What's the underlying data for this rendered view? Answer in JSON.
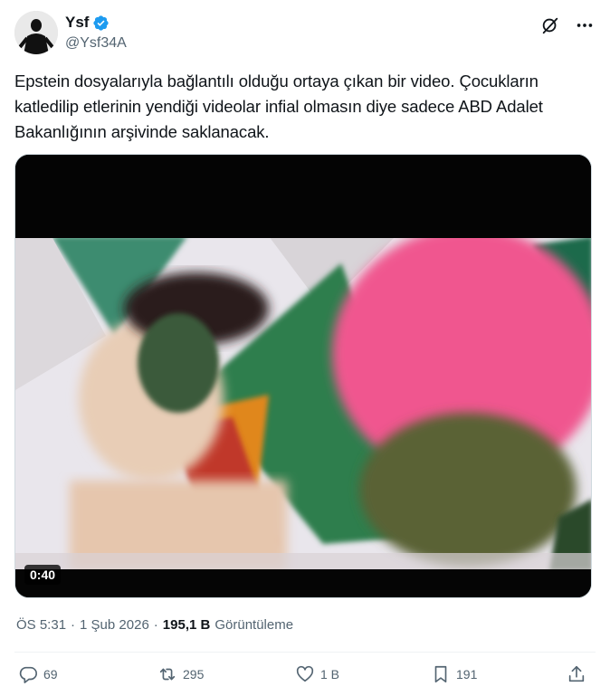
{
  "author": {
    "display_name": "Ysf",
    "handle": "@Ysf34A",
    "verified": true,
    "avatar_icon": "avatar-person-icon"
  },
  "tweet": {
    "text": "Epstein dosyalarıyla bağlantılı olduğu ortaya çıkan bir video. Çocukların katledilip etlerinin yendiği videolar infial olmasın diye sadece ABD Adalet Bakanlığının arşivinde saklanacak."
  },
  "media": {
    "duration": "0:40"
  },
  "meta": {
    "time": "ÖS 5:31",
    "separator": "·",
    "date": "1 Şub 2026",
    "views_count": "195,1 B",
    "views_label": "Görüntüleme"
  },
  "actions": {
    "reply_count": "69",
    "retweet_count": "295",
    "like_count": "1 B",
    "bookmark_count": "191"
  },
  "colors": {
    "accent": "#1d9bf0",
    "text_primary": "#0f1419",
    "text_secondary": "#536471"
  }
}
